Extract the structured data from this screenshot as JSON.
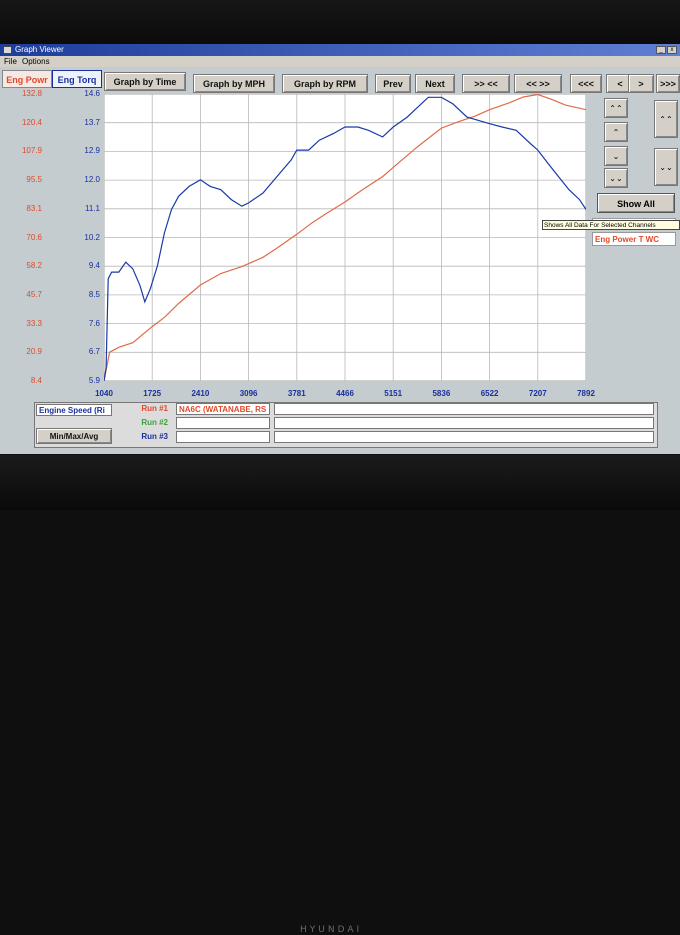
{
  "window": {
    "title": "Graph Viewer",
    "menu": [
      "File",
      "Options"
    ]
  },
  "channels": {
    "left": "Eng Powr",
    "right": "Eng Torq"
  },
  "toolbar": {
    "graph_time": "Graph by Time",
    "graph_mph": "Graph by MPH",
    "graph_rpm": "Graph by RPM",
    "prev": "Prev",
    "next": "Next",
    "zoom_in": ">> <<",
    "zoom_out": "<< >>",
    "first": "<<<",
    "left": "<",
    "right": ">",
    "last": ">>>"
  },
  "side": {
    "up_fast": "⌃⌃",
    "up": "⌃",
    "down": "⌄",
    "down_fast": "⌄⌄",
    "r_up_fast": "⌃⌃",
    "r_down_fast": "⌄⌄",
    "show_all": "Show All",
    "tooltip": "Shows All Data For Selected Channels",
    "legend_power": "Eng Power T WC"
  },
  "bottom": {
    "x_channel": "Engine Speed (Ri",
    "minmax": "Min/Max/Avg",
    "runs": [
      {
        "label": "Run #1",
        "name": "NA6C (WATANABE, RS",
        "color": "#e04a2a"
      },
      {
        "label": "Run #2",
        "name": "",
        "color": "#3aa33a"
      },
      {
        "label": "Run #3",
        "name": "",
        "color": "#1a2f9c"
      }
    ]
  },
  "chart_data": {
    "type": "line",
    "xlabel": "",
    "xticks": [
      "1040",
      "1725",
      "2410",
      "3096",
      "3781",
      "4466",
      "5151",
      "5836",
      "6522",
      "7207",
      "7892"
    ],
    "xlim": [
      1040,
      7892
    ],
    "y_left_ticks": [
      "132.8",
      "120.4",
      "107.9",
      "95.5",
      "83.1",
      "70.6",
      "58.2",
      "45.7",
      "33.3",
      "20.9",
      "8.4"
    ],
    "y_left_lim": [
      8.4,
      132.8
    ],
    "y_right_ticks": [
      "14.6",
      "13.7",
      "12.9",
      "12.0",
      "11.1",
      "10.2",
      "9.4",
      "8.5",
      "7.6",
      "6.7",
      "5.9"
    ],
    "y_right_lim": [
      5.9,
      14.6
    ],
    "grid": true,
    "series": [
      {
        "axis": "left",
        "color": "#e06a4a",
        "points": [
          [
            1040,
            8.4
          ],
          [
            1120,
            20.9
          ],
          [
            1250,
            23
          ],
          [
            1450,
            25
          ],
          [
            1725,
            32
          ],
          [
            1900,
            36
          ],
          [
            2100,
            42
          ],
          [
            2410,
            50
          ],
          [
            2700,
            55
          ],
          [
            3000,
            58
          ],
          [
            3300,
            62
          ],
          [
            3500,
            66
          ],
          [
            3781,
            72
          ],
          [
            4000,
            77
          ],
          [
            4200,
            81
          ],
          [
            4466,
            86
          ],
          [
            4700,
            91
          ],
          [
            5000,
            97
          ],
          [
            5151,
            101
          ],
          [
            5500,
            110
          ],
          [
            5836,
            118
          ],
          [
            6100,
            121
          ],
          [
            6300,
            123
          ],
          [
            6522,
            126
          ],
          [
            6800,
            129
          ],
          [
            7000,
            131.5
          ],
          [
            7207,
            132.6
          ],
          [
            7400,
            130.5
          ],
          [
            7600,
            128
          ],
          [
            7892,
            126
          ]
        ]
      },
      {
        "axis": "right",
        "color": "#1a3aa8",
        "points": [
          [
            1040,
            5.9
          ],
          [
            1070,
            6.3
          ],
          [
            1100,
            9.0
          ],
          [
            1150,
            9.2
          ],
          [
            1250,
            9.2
          ],
          [
            1350,
            9.5
          ],
          [
            1450,
            9.3
          ],
          [
            1550,
            8.8
          ],
          [
            1620,
            8.3
          ],
          [
            1700,
            8.7
          ],
          [
            1800,
            9.4
          ],
          [
            1900,
            10.4
          ],
          [
            2000,
            11.1
          ],
          [
            2100,
            11.5
          ],
          [
            2250,
            11.8
          ],
          [
            2410,
            12.0
          ],
          [
            2550,
            11.8
          ],
          [
            2700,
            11.7
          ],
          [
            2850,
            11.4
          ],
          [
            3000,
            11.2
          ],
          [
            3096,
            11.3
          ],
          [
            3300,
            11.6
          ],
          [
            3500,
            12.1
          ],
          [
            3700,
            12.6
          ],
          [
            3781,
            12.9
          ],
          [
            3950,
            12.9
          ],
          [
            4100,
            13.2
          ],
          [
            4300,
            13.4
          ],
          [
            4466,
            13.6
          ],
          [
            4650,
            13.6
          ],
          [
            4800,
            13.5
          ],
          [
            5000,
            13.3
          ],
          [
            5151,
            13.6
          ],
          [
            5350,
            13.9
          ],
          [
            5500,
            14.2
          ],
          [
            5650,
            14.5
          ],
          [
            5836,
            14.5
          ],
          [
            6000,
            14.3
          ],
          [
            6200,
            13.9
          ],
          [
            6522,
            13.7
          ],
          [
            6700,
            13.6
          ],
          [
            6900,
            13.5
          ],
          [
            7100,
            13.1
          ],
          [
            7207,
            12.9
          ],
          [
            7350,
            12.5
          ],
          [
            7500,
            12.1
          ],
          [
            7650,
            11.7
          ],
          [
            7800,
            11.4
          ],
          [
            7892,
            11.1
          ]
        ]
      }
    ]
  }
}
